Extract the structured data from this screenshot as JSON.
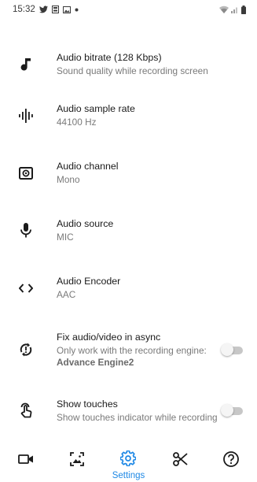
{
  "status_bar": {
    "time": "15:32",
    "left_icons": [
      "twitter-icon",
      "sim-icon",
      "gallery-icon",
      "dot-icon"
    ],
    "right_icons": [
      "wifi-icon",
      "signal-icon",
      "battery-icon"
    ]
  },
  "settings": [
    {
      "icon": "music-note-icon",
      "title": "Audio bitrate (128 Kbps)",
      "subtitle": "Sound quality while recording screen"
    },
    {
      "icon": "waveform-icon",
      "title": "Audio sample rate",
      "subtitle": "44100 Hz"
    },
    {
      "icon": "speaker-channel-icon",
      "title": "Audio channel",
      "subtitle": "Mono"
    },
    {
      "icon": "microphone-icon",
      "title": "Audio source",
      "subtitle": "MIC"
    },
    {
      "icon": "code-brackets-icon",
      "title": "Audio Encoder",
      "subtitle": "AAC"
    },
    {
      "icon": "sync-icon",
      "title": "Fix audio/video in async",
      "subtitle": "Only work with the recording engine:",
      "subtitle_bold": "Advance Engine2",
      "toggle": false
    },
    {
      "icon": "touch-icon",
      "title": "Show touches",
      "subtitle": "Show touches indicator while recording",
      "toggle": false
    }
  ],
  "bottom_nav": [
    {
      "icon": "video-camera-icon",
      "label": "",
      "active": false
    },
    {
      "icon": "image-icon",
      "label": "",
      "active": false
    },
    {
      "icon": "settings-gear-icon",
      "label": "Settings",
      "active": true
    },
    {
      "icon": "scissors-icon",
      "label": "",
      "active": false
    },
    {
      "icon": "help-icon",
      "label": "",
      "active": false
    }
  ],
  "colors": {
    "accent": "#1e88e5",
    "text_primary": "#1b1b1b",
    "text_secondary": "#7a7a7a",
    "toggle_track": "#c7c7c7"
  }
}
